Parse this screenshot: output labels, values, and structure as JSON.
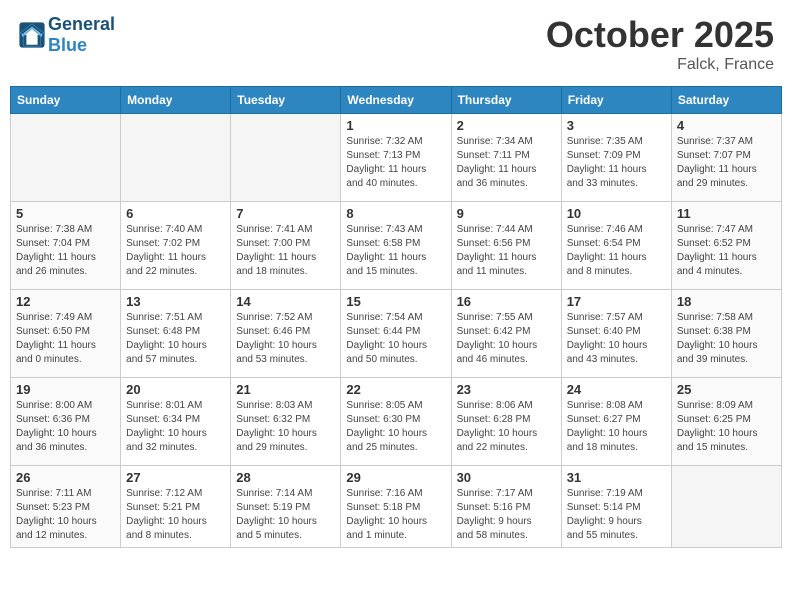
{
  "header": {
    "logo_general": "General",
    "logo_blue": "Blue",
    "month": "October 2025",
    "location": "Falck, France"
  },
  "weekdays": [
    "Sunday",
    "Monday",
    "Tuesday",
    "Wednesday",
    "Thursday",
    "Friday",
    "Saturday"
  ],
  "weeks": [
    [
      {
        "day": "",
        "info": ""
      },
      {
        "day": "",
        "info": ""
      },
      {
        "day": "",
        "info": ""
      },
      {
        "day": "1",
        "info": "Sunrise: 7:32 AM\nSunset: 7:13 PM\nDaylight: 11 hours\nand 40 minutes."
      },
      {
        "day": "2",
        "info": "Sunrise: 7:34 AM\nSunset: 7:11 PM\nDaylight: 11 hours\nand 36 minutes."
      },
      {
        "day": "3",
        "info": "Sunrise: 7:35 AM\nSunset: 7:09 PM\nDaylight: 11 hours\nand 33 minutes."
      },
      {
        "day": "4",
        "info": "Sunrise: 7:37 AM\nSunset: 7:07 PM\nDaylight: 11 hours\nand 29 minutes."
      }
    ],
    [
      {
        "day": "5",
        "info": "Sunrise: 7:38 AM\nSunset: 7:04 PM\nDaylight: 11 hours\nand 26 minutes."
      },
      {
        "day": "6",
        "info": "Sunrise: 7:40 AM\nSunset: 7:02 PM\nDaylight: 11 hours\nand 22 minutes."
      },
      {
        "day": "7",
        "info": "Sunrise: 7:41 AM\nSunset: 7:00 PM\nDaylight: 11 hours\nand 18 minutes."
      },
      {
        "day": "8",
        "info": "Sunrise: 7:43 AM\nSunset: 6:58 PM\nDaylight: 11 hours\nand 15 minutes."
      },
      {
        "day": "9",
        "info": "Sunrise: 7:44 AM\nSunset: 6:56 PM\nDaylight: 11 hours\nand 11 minutes."
      },
      {
        "day": "10",
        "info": "Sunrise: 7:46 AM\nSunset: 6:54 PM\nDaylight: 11 hours\nand 8 minutes."
      },
      {
        "day": "11",
        "info": "Sunrise: 7:47 AM\nSunset: 6:52 PM\nDaylight: 11 hours\nand 4 minutes."
      }
    ],
    [
      {
        "day": "12",
        "info": "Sunrise: 7:49 AM\nSunset: 6:50 PM\nDaylight: 11 hours\nand 0 minutes."
      },
      {
        "day": "13",
        "info": "Sunrise: 7:51 AM\nSunset: 6:48 PM\nDaylight: 10 hours\nand 57 minutes."
      },
      {
        "day": "14",
        "info": "Sunrise: 7:52 AM\nSunset: 6:46 PM\nDaylight: 10 hours\nand 53 minutes."
      },
      {
        "day": "15",
        "info": "Sunrise: 7:54 AM\nSunset: 6:44 PM\nDaylight: 10 hours\nand 50 minutes."
      },
      {
        "day": "16",
        "info": "Sunrise: 7:55 AM\nSunset: 6:42 PM\nDaylight: 10 hours\nand 46 minutes."
      },
      {
        "day": "17",
        "info": "Sunrise: 7:57 AM\nSunset: 6:40 PM\nDaylight: 10 hours\nand 43 minutes."
      },
      {
        "day": "18",
        "info": "Sunrise: 7:58 AM\nSunset: 6:38 PM\nDaylight: 10 hours\nand 39 minutes."
      }
    ],
    [
      {
        "day": "19",
        "info": "Sunrise: 8:00 AM\nSunset: 6:36 PM\nDaylight: 10 hours\nand 36 minutes."
      },
      {
        "day": "20",
        "info": "Sunrise: 8:01 AM\nSunset: 6:34 PM\nDaylight: 10 hours\nand 32 minutes."
      },
      {
        "day": "21",
        "info": "Sunrise: 8:03 AM\nSunset: 6:32 PM\nDaylight: 10 hours\nand 29 minutes."
      },
      {
        "day": "22",
        "info": "Sunrise: 8:05 AM\nSunset: 6:30 PM\nDaylight: 10 hours\nand 25 minutes."
      },
      {
        "day": "23",
        "info": "Sunrise: 8:06 AM\nSunset: 6:28 PM\nDaylight: 10 hours\nand 22 minutes."
      },
      {
        "day": "24",
        "info": "Sunrise: 8:08 AM\nSunset: 6:27 PM\nDaylight: 10 hours\nand 18 minutes."
      },
      {
        "day": "25",
        "info": "Sunrise: 8:09 AM\nSunset: 6:25 PM\nDaylight: 10 hours\nand 15 minutes."
      }
    ],
    [
      {
        "day": "26",
        "info": "Sunrise: 7:11 AM\nSunset: 5:23 PM\nDaylight: 10 hours\nand 12 minutes."
      },
      {
        "day": "27",
        "info": "Sunrise: 7:12 AM\nSunset: 5:21 PM\nDaylight: 10 hours\nand 8 minutes."
      },
      {
        "day": "28",
        "info": "Sunrise: 7:14 AM\nSunset: 5:19 PM\nDaylight: 10 hours\nand 5 minutes."
      },
      {
        "day": "29",
        "info": "Sunrise: 7:16 AM\nSunset: 5:18 PM\nDaylight: 10 hours\nand 1 minute."
      },
      {
        "day": "30",
        "info": "Sunrise: 7:17 AM\nSunset: 5:16 PM\nDaylight: 9 hours\nand 58 minutes."
      },
      {
        "day": "31",
        "info": "Sunrise: 7:19 AM\nSunset: 5:14 PM\nDaylight: 9 hours\nand 55 minutes."
      },
      {
        "day": "",
        "info": ""
      }
    ]
  ]
}
